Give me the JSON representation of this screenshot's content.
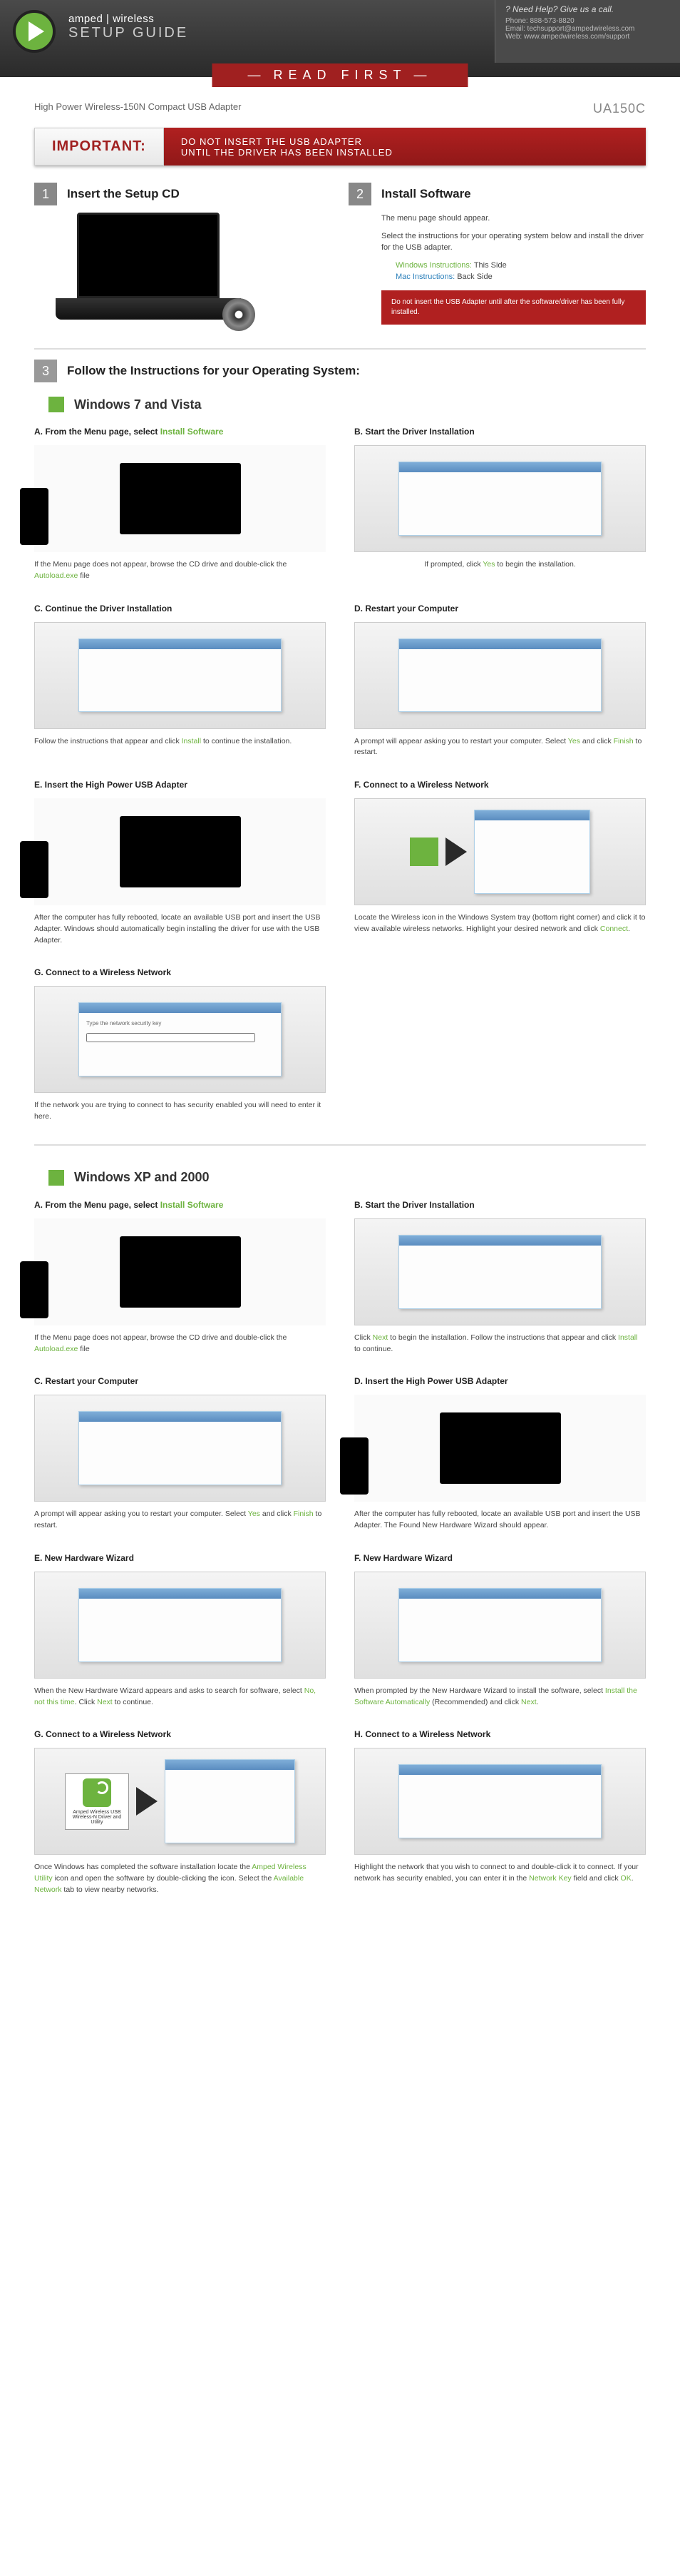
{
  "header": {
    "brand_line1": "amped | wireless",
    "brand_line2": "SETUP GUIDE",
    "help_title": "?  Need Help?  Give us a call.",
    "phone": "Phone: 888-573-8820",
    "email": "Email: techsupport@ampedwireless.com",
    "web": "Web: www.ampedwireless.com/support",
    "read_first": "READ FIRST"
  },
  "product": {
    "name": "High Power Wireless-150N Compact USB Adapter",
    "model": "UA150C"
  },
  "important": {
    "label": "IMPORTANT:",
    "text1": "DO NOT INSERT THE USB ADAPTER",
    "text2": "UNTIL THE DRIVER HAS BEEN INSTALLED"
  },
  "step1": {
    "num": "1",
    "title": "Insert the Setup CD"
  },
  "step2": {
    "num": "2",
    "title": "Install Software",
    "p1": "The menu page should appear.",
    "p2": "Select the instructions for your operating system below and install the driver for the USB adapter.",
    "win_label": "Windows Instructions:",
    "win_val": "  This Side",
    "mac_label": "Mac Instructions:",
    "mac_val": "  Back Side",
    "warn": "Do not insert the USB Adapter until after the software/driver has been fully installed."
  },
  "step3": {
    "num": "3",
    "title": "Follow the Instructions for your Operating System:"
  },
  "os1": {
    "title": "Windows 7 and Vista"
  },
  "os2": {
    "title": "Windows XP and 2000"
  },
  "w7": {
    "a_title": "A. From the Menu page, select ",
    "a_action": "Install Software",
    "a_desc1": "If the Menu page does not appear, browse the CD drive and double-click the ",
    "a_desc2": "Autoload.exe",
    "a_desc3": " file",
    "b_title": "B. Start the Driver Installation",
    "b_desc1": "If prompted, click ",
    "b_desc2": "Yes",
    "b_desc3": " to begin the installation.",
    "c_title": "C. Continue the Driver Installation",
    "c_desc1": "Follow the instructions that appear and click ",
    "c_desc2": "Install",
    "c_desc3": " to continue the installation.",
    "d_title": "D. Restart your Computer",
    "d_desc1": "A prompt will appear asking you to restart your computer.  Select ",
    "d_desc2": "Yes",
    "d_desc3": " and click ",
    "d_desc4": "Finish",
    "d_desc5": " to restart.",
    "e_title": "E. Insert the High Power USB Adapter",
    "e_desc": "After the computer has fully rebooted, locate an available USB port and insert the USB Adapter. Windows should automatically begin installing the driver for use with the USB Adapter.",
    "f_title": "F. Connect to a Wireless Network",
    "f_desc1": "Locate the Wireless icon in the Windows System tray (bottom right corner) and click it to view available wireless networks.  Highlight your desired network and click ",
    "f_desc2": "Connect",
    "f_desc3": ".",
    "g_title": "G. Connect to a Wireless Network",
    "g_desc": "If the network you are trying to connect to has security enabled you will need to enter it here."
  },
  "xp": {
    "a_title": "A. From the Menu page, select ",
    "a_action": "Install Software",
    "a_desc1": "If the Menu page does not appear, browse the CD drive and double-click the ",
    "a_desc2": "Autoload.exe",
    "a_desc3": " file",
    "b_title": "B. Start the Driver Installation",
    "b_desc1": "Click ",
    "b_desc2": "Next",
    "b_desc3": " to begin the installation.  Follow the instructions that appear and click ",
    "b_desc4": "Install",
    "b_desc5": " to continue.",
    "c_title": "C. Restart your Computer",
    "c_desc1": "A prompt will appear asking you to restart your computer.  Select ",
    "c_desc2": "Yes",
    "c_desc3": " and click ",
    "c_desc4": "Finish",
    "c_desc5": " to restart.",
    "d_title": "D. Insert the High Power USB Adapter",
    "d_desc": "After the computer has fully rebooted, locate an available USB port and insert the USB Adapter. The Found New Hardware Wizard should appear.",
    "e_title": "E. New Hardware Wizard",
    "e_desc1": "When the New Hardware Wizard appears and asks to search for software, select ",
    "e_desc2": "No, not this time",
    "e_desc3": ". Click ",
    "e_desc4": "Next",
    "e_desc5": " to continue.",
    "f_title": "F. New Hardware Wizard",
    "f_desc1": "When prompted by the New Hardware Wizard to install the software, select ",
    "f_desc2": "Install the Software Automatically",
    "f_desc3": " (Recommended) and click ",
    "f_desc4": "Next",
    "f_desc5": ".",
    "g_title": "G. Connect to a Wireless Network",
    "g_util": "Amped Wireless USB Wireless-N Driver and Utility",
    "g_desc1": "Once Windows has completed the software installation locate the ",
    "g_desc2": "Amped Wireless Utility",
    "g_desc3": " icon and open the software by double-clicking the icon.  Select the ",
    "g_desc4": "Available Network",
    "g_desc5": " tab to view nearby networks.",
    "h_title": "H. Connect to a Wireless Network",
    "h_desc1": "Highlight the network that you wish to connect to and double-click it to connect.  If your network has security enabled, you can enter it in the ",
    "h_desc2": "Network Key",
    "h_desc3": " field and click ",
    "h_desc4": "OK",
    "h_desc5": "."
  }
}
